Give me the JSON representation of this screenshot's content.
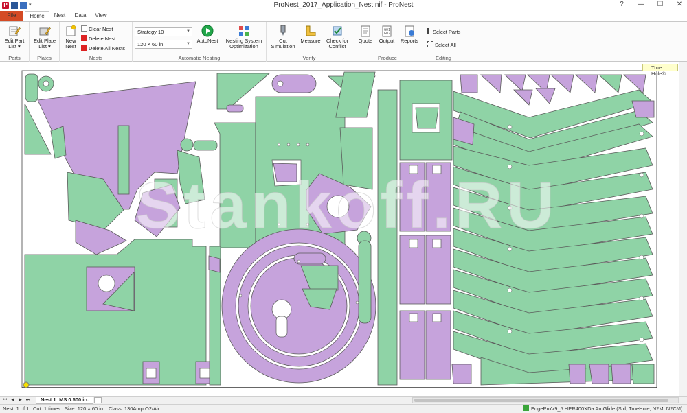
{
  "window": {
    "title": "ProNest_2017_Application_Nest.nif - ProNest",
    "app_icon": "P",
    "qat_more": "▾",
    "controls": {
      "help": "?",
      "minimize": "—",
      "maximize": "☐",
      "close": "✕"
    }
  },
  "tabs": {
    "file": "File",
    "home": "Home",
    "nest": "Nest",
    "data": "Data",
    "view": "View"
  },
  "ribbon": {
    "parts": {
      "label": "Parts",
      "edit_part_list": "Edit Part List ▾"
    },
    "plates": {
      "label": "Plates",
      "edit_plate_list": "Edit Plate List ▾"
    },
    "nests": {
      "label": "Nests",
      "new_nest": "New Nest",
      "clear_nest": "Clear Nest",
      "delete_nest": "Delete Nest",
      "delete_all_nests": "Delete All Nests"
    },
    "automatic_nesting": {
      "label": "Automatic Nesting",
      "strategy": "Strategy 10",
      "plate_size": "120 × 60 in.",
      "autonest": "AutoNest",
      "nesting_system_optimization": "Nesting System Optimization"
    },
    "verify": {
      "label": "Verify",
      "cut_simulation": "Cut Simulation",
      "measure": "Measure",
      "check_for_conflict": "Check for Conflict"
    },
    "produce": {
      "label": "Produce",
      "quote": "Quote",
      "output": "Output",
      "reports": "Reports"
    },
    "editing": {
      "label": "Editing",
      "select_parts": "Select Parts",
      "select_all": "Select All"
    }
  },
  "canvas": {
    "true_hole_badge": "True Hole®",
    "watermark": "Stankoff.RU",
    "colors": {
      "part_green": "#8fd3a6",
      "part_purple": "#c6a3dc",
      "outline": "#555555",
      "plate_bg": "#ffffff"
    }
  },
  "nest_tabs": {
    "active": "Nest 1: MS 0.500 in."
  },
  "status": {
    "nest": "Nest: 1 of 1",
    "cut": "Cut: 1 times",
    "size": "Size: 120 × 60 in.",
    "class": "Class: 130Amp O2/Air",
    "machine": "EdgeProV9_5 HPR400XDa ArcGlide (Std, TrueHole, N2M, N2CM)"
  },
  "icons": {
    "edit_part_list": "edit-part-list-icon",
    "edit_plate_list": "edit-plate-list-icon",
    "new_nest": "new-nest-icon",
    "autonest": "play-icon",
    "cut_simulation": "cut-simulation-icon",
    "measure": "measure-icon",
    "check_for_conflict": "checkmark-shield-icon",
    "quote": "quote-icon",
    "output": "output-icon",
    "reports": "reports-icon"
  }
}
